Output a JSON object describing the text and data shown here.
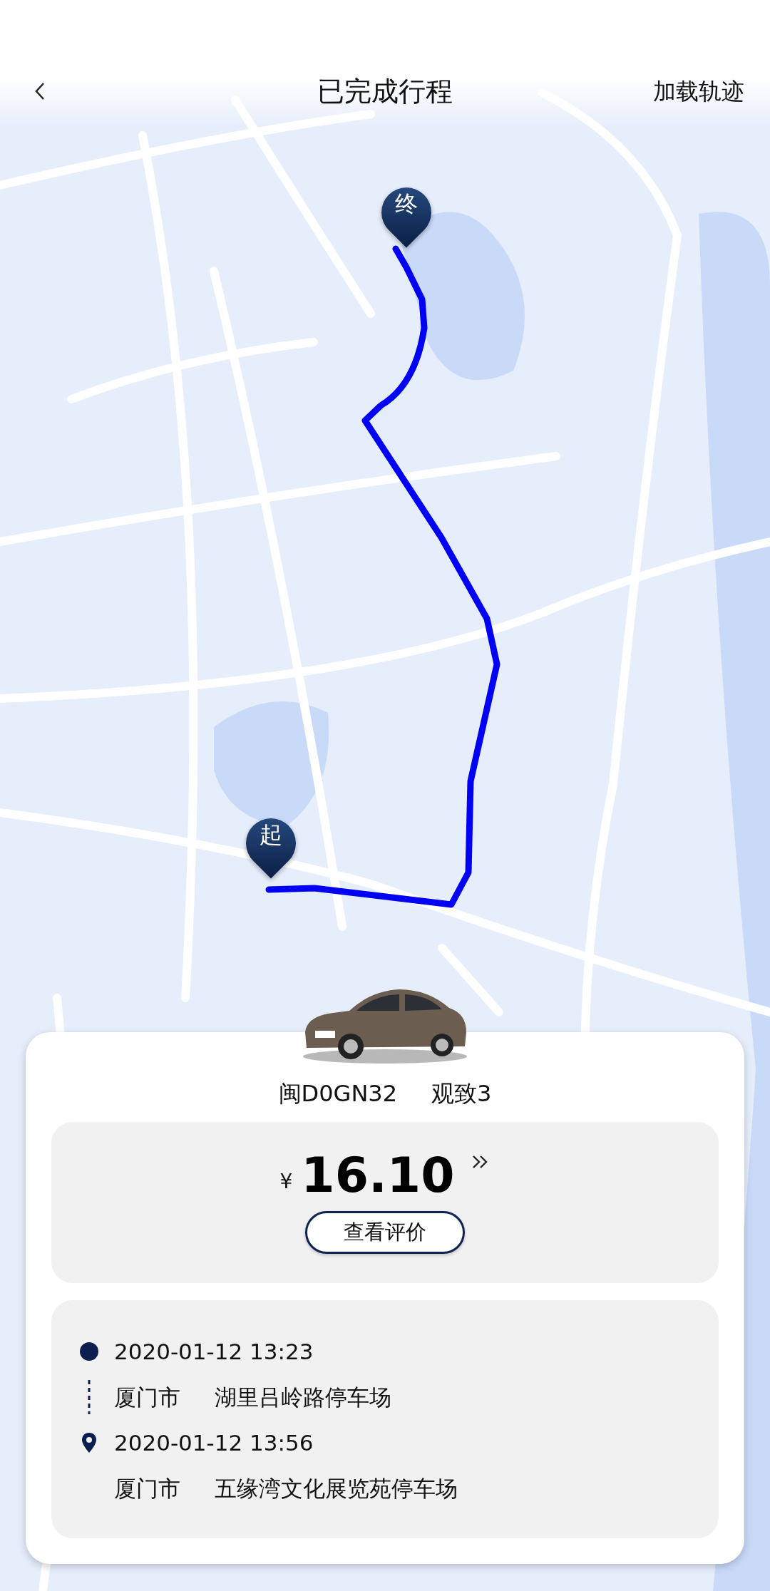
{
  "header": {
    "title": "已完成行程",
    "action": "加载轨迹"
  },
  "map": {
    "pins": [
      {
        "kind": "start",
        "label": "起"
      },
      {
        "kind": "end",
        "label": "终"
      }
    ]
  },
  "vehicle": {
    "plate": "闽D0GN32",
    "model": "观致3"
  },
  "fare": {
    "currency": "¥",
    "amount": "16.10",
    "action": "查看评价"
  },
  "trip": [
    {
      "kind": "start",
      "time": "2020-01-12 13:23",
      "city": "厦门市",
      "place": "湖里吕岭路停车场"
    },
    {
      "kind": "end",
      "time": "2020-01-12 13:56",
      "city": "厦门市",
      "place": "五缘湾文化展览苑停车场"
    }
  ]
}
